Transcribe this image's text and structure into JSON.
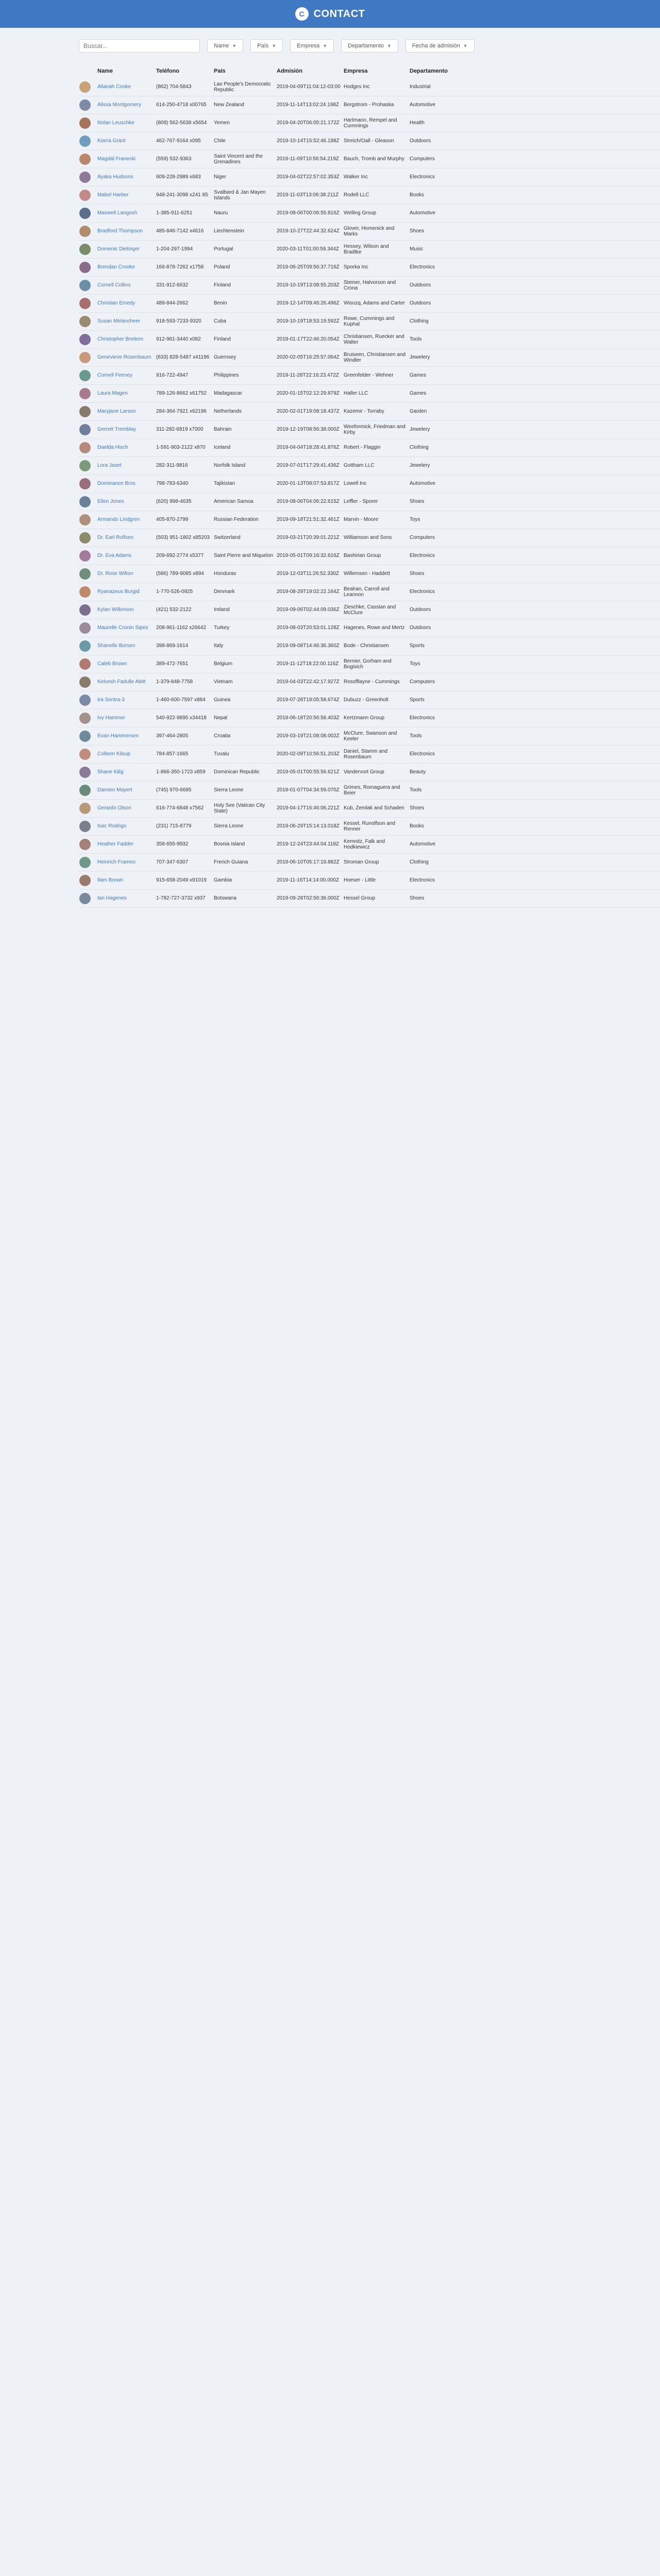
{
  "header": {
    "brand": "CONTACT",
    "logo_glyph": "C"
  },
  "filters": {
    "search_placeholder": "Buscar...",
    "name": "Name",
    "pais": "País",
    "empresa": "Empresa",
    "departamento": "Departamento",
    "fecha": "Fecha de admisión"
  },
  "columns": [
    "Name",
    "Teléfono",
    "País",
    "Admisión",
    "Empresa",
    "Departamento"
  ],
  "rows": [
    {
      "name": "Allanah Cooke",
      "phone": "(862) 704-5843",
      "pais": "Lao People's Democratic Republic",
      "admision": "2019-04-09T11:04:12-03:00",
      "empresa": "Hodges Inc",
      "dep": "Industrial",
      "color": "#c9a27a"
    },
    {
      "name": "Alissa Montgomery",
      "phone": "614-250-4718 x00765",
      "pais": "New Zealand",
      "admision": "2019-11-14T13:02:24.198Z",
      "empresa": "Bergstrom - Prohaska",
      "dep": "Automotive",
      "color": "#7d8aa6"
    },
    {
      "name": "Nolan Leuschke",
      "phone": "(809) 562-5638 x5654",
      "pais": "Yemen",
      "admision": "2019-04-20T06:05:21.172Z",
      "empresa": "Hartmann, Rempel and Cummings",
      "dep": "Health",
      "color": "#a5735a"
    },
    {
      "name": "Kiarra Grant",
      "phone": "462-767-9164 x095",
      "pais": "Chile",
      "admision": "2019-10-14T15:52:46.198Z",
      "empresa": "Streich/Oall - Gleason",
      "dep": "Outdoors",
      "color": "#6f9dbf"
    },
    {
      "name": "Magdal Franecki",
      "phone": "(559) 532-9363",
      "pais": "Saint Vincent and the Grenadines",
      "admision": "2019-11-09T10:56:54.219Z",
      "empresa": "Bauch, Tromb and Murphy",
      "dep": "Computers",
      "color": "#b9876a"
    },
    {
      "name": "Ayaka Hudsons",
      "phone": "609-228-2989 x683",
      "pais": "Niger",
      "admision": "2019-04-02T22:57:02.353Z",
      "empresa": "Walker Inc",
      "dep": "Electronics",
      "color": "#8f7a9c"
    },
    {
      "name": "Mabel Harber",
      "phone": "948-241-3098 x241 85",
      "pais": "Svalbard & Jan Mayen Islands",
      "admision": "2019-11-03T13:06:38.211Z",
      "empresa": "Rodell LLC",
      "dep": "Books",
      "color": "#c48a8a"
    },
    {
      "name": "Maxwell Langosh",
      "phone": "1-385-911-6251",
      "pais": "Nauru",
      "admision": "2019-08-06T00:06:55.816Z",
      "empresa": "Welling Group",
      "dep": "Automotive",
      "color": "#5a6f8c"
    },
    {
      "name": "Bradford Thompson",
      "phone": "485-846-7142 x4616",
      "pais": "Liechtenstein",
      "admision": "2019-10-27T22:44:32.624Z",
      "empresa": "Glover, Homenick and Marks",
      "dep": "Shoes",
      "color": "#b08e6c"
    },
    {
      "name": "Domenic Dietinger",
      "phone": "1-204-297-1994",
      "pais": "Portugal",
      "admision": "2020-03-11T01:00:59.344Z",
      "empresa": "Hessey, Wilson and Bradtke",
      "dep": "Music",
      "color": "#7a8c6a"
    },
    {
      "name": "Brendan Crooke",
      "phone": "166-878-7262 x1758",
      "pais": "Poland",
      "admision": "2019-06-25T09:56:37.716Z",
      "empresa": "Sporka Inc",
      "dep": "Electronics",
      "color": "#8c6a8a"
    },
    {
      "name": "Cornell Collins",
      "phone": "331-912-6632",
      "pais": "Finland",
      "admision": "2019-10-19T13:08:55.203Z",
      "empresa": "Steiner, Halvorson and Crona",
      "dep": "Outdoors",
      "color": "#6a8fa6"
    },
    {
      "name": "Christian Emedy",
      "phone": "489-844-2662",
      "pais": "Benin",
      "admision": "2019-12-14T09:46:26.496Z",
      "empresa": "Wisozq, Adams and Carter",
      "dep": "Outdoors",
      "color": "#a6706a"
    },
    {
      "name": "Susan Melancheer",
      "phone": "918-593-7233-9320",
      "pais": "Cuba",
      "admision": "2019-10-19T18:53:19.592Z",
      "empresa": "Rowe, Cummings and Kuphal",
      "dep": "Clothing",
      "color": "#9a8a6f"
    },
    {
      "name": "Christopher Breitem",
      "phone": "912-961-3440 x082",
      "pais": "Finland",
      "admision": "2019-01-17T22:46:20.054Z",
      "empresa": "Christiansen, Ruecker and Walter",
      "dep": "Tools",
      "color": "#7f6f9a"
    },
    {
      "name": "Genevieve Rosenbaum",
      "phone": "(633) 828-5487 x41196",
      "pais": "Guernsey",
      "admision": "2020-02-05T16:25:57.064Z",
      "empresa": "Bruiseen, Christiansen and Windler",
      "dep": "Jewelery",
      "color": "#c79a7c"
    },
    {
      "name": "Cornell Feeney",
      "phone": "916-722-4947",
      "pais": "Philippines",
      "admision": "2019-11-28T22:16:23.472Z",
      "empresa": "Greenfelder - Wehner",
      "dep": "Games",
      "color": "#6a9a8c"
    },
    {
      "name": "Laura Magen",
      "phone": "789-126-8662 x61752",
      "pais": "Madagascar",
      "admision": "2020-01-15T02:12:29.879Z",
      "empresa": "Haller LLC",
      "dep": "Games",
      "color": "#a67c8c"
    },
    {
      "name": "Maryjane Larson",
      "phone": "284-364-7921 x62196",
      "pais": "Netherlands",
      "admision": "2020-02-01T19:08:18.437Z",
      "empresa": "Kazemir - Torraby",
      "dep": "Garden",
      "color": "#8a7a6a"
    },
    {
      "name": "Gerrett Tremblay",
      "phone": "311-282-6819 x7000",
      "pais": "Bahrain",
      "admision": "2019-12-19T08:56:38.000Z",
      "empresa": "Weeformick, Friedman and Kirby",
      "dep": "Jewelery",
      "color": "#6f7f9c"
    },
    {
      "name": "Daelda Hisch",
      "phone": "1-591-903-2122 x870",
      "pais": "Iceland",
      "admision": "2019-04-04T18:28:41.876Z",
      "empresa": "Robert - Flaggin",
      "dep": "Clothing",
      "color": "#b58a7a"
    },
    {
      "name": "Lora Jaset",
      "phone": "282-311-9816",
      "pais": "Norfolk Island",
      "admision": "2019-07-01T17:29:41.436Z",
      "empresa": "Gottham LLC",
      "dep": "Jewelery",
      "color": "#7c9a7a"
    },
    {
      "name": "Dominance Bros",
      "phone": "798-783-6340",
      "pais": "Tajikistan",
      "admision": "2020-01-13T08:07:53.817Z",
      "empresa": "Lowell Inc",
      "dep": "Automotive",
      "color": "#9a6f7a"
    },
    {
      "name": "Ellen Jones",
      "phone": "(620) 998-4635",
      "pais": "American Samoa",
      "admision": "2019-08-06T04:06:22.615Z",
      "empresa": "Leffler - Sporer",
      "dep": "Shoes",
      "color": "#6a7f9a"
    },
    {
      "name": "Armando Lindgren",
      "phone": "405-870-2799",
      "pais": "Russian Federation",
      "admision": "2019-09-18T21:51:32.461Z",
      "empresa": "Marvin - Moore",
      "dep": "Toys",
      "color": "#b0907a"
    },
    {
      "name": "Dr. Earl Rolfsen",
      "phone": "(503) 951-1802 x85203",
      "pais": "Switzerland",
      "admision": "2019-03-21T20:39:01.221Z",
      "empresa": "Williamson and Sons",
      "dep": "Computers",
      "color": "#8c8c6a"
    },
    {
      "name": "Dr. Eva Adams",
      "phone": "209-692-2774 x5377",
      "pais": "Saint Pierre and Miquelon",
      "admision": "2019-05-01T09:16:32.616Z",
      "empresa": "Bashirian Group",
      "dep": "Electronics",
      "color": "#a67a9a"
    },
    {
      "name": "Dr. Rose Wilton",
      "phone": "(586) 789-9085 x894",
      "pais": "Honduras",
      "admision": "2019-12-03T11:26:52.330Z",
      "empresa": "Willemsen - Haddett",
      "dep": "Shoes",
      "color": "#6f8f7a"
    },
    {
      "name": "Ryanazeus Burgid",
      "phone": "1-770-526-0925",
      "pais": "Denmark",
      "admision": "2019-08-29T19:02:22.164Z",
      "empresa": "Beahan, Carroll and Leannon",
      "dep": "Electronics",
      "color": "#c08a6a"
    },
    {
      "name": "Kylan Wilkinson",
      "phone": "(421) 532-2122",
      "pais": "Ireland",
      "admision": "2019-09-06T02:44:09.036Z",
      "empresa": "Zieschke, Cassian and McClure",
      "dep": "Outdoors",
      "color": "#7a6f8c"
    },
    {
      "name": "Maurelle Cronin Sipes",
      "phone": "208-961-1162 x26642",
      "pais": "Turkey",
      "admision": "2019-08-03T20:53:01.128Z",
      "empresa": "Hagenes, Rowe and Mertz",
      "dep": "Outdoors",
      "color": "#9a8a9c"
    },
    {
      "name": "Shanelle Borsen",
      "phone": "398-869-1614",
      "pais": "Italy",
      "admision": "2019-09-08T14:46:36.360Z",
      "empresa": "Bode - Christiansen",
      "dep": "Sports",
      "color": "#6a9aa6"
    },
    {
      "name": "Caleb Brown",
      "phone": "389-472-7651",
      "pais": "Belgium",
      "admision": "2019-11-12T18:22:00.116Z",
      "empresa": "Bernier, Gorham and Bogisich",
      "dep": "Toys",
      "color": "#b07a6f"
    },
    {
      "name": "Kelvesh Fadulle Abitt",
      "phone": "1-379-848-7758",
      "pais": "Vietnam",
      "admision": "2019-04-03T22:42:17.927Z",
      "empresa": "Rossfflayne - Cummings",
      "dep": "Computers",
      "color": "#8a7c6a"
    },
    {
      "name": "Ira Sentra-3",
      "phone": "1-460-600-7597 x884",
      "pais": "Guinea",
      "admision": "2019-07-28T19:05:58.674Z",
      "empresa": "Dubuzz - Greenholt",
      "dep": "Sports",
      "color": "#7c8aa6"
    },
    {
      "name": "Ivy Hammer",
      "phone": "540-922-9895 x34418",
      "pais": "Nepal",
      "admision": "2019-06-18T20:56:58.403Z",
      "empresa": "Kertzmann Group",
      "dep": "Electronics",
      "color": "#a6908a"
    },
    {
      "name": "Evan Hammersen",
      "phone": "397-464-2805",
      "pais": "Croatia",
      "admision": "2019-03-19T21:08:08.002Z",
      "empresa": "McClure, Swanson and Keeler",
      "dep": "Tools",
      "color": "#6f8a9a"
    },
    {
      "name": "Colleen Kilsup",
      "phone": "784-857-1665",
      "pais": "Tuvalu",
      "admision": "2020-02-09T10:56:51.203Z",
      "empresa": "Daniel, Stamm and Rosenbaum",
      "dep": "Electronics",
      "color": "#c08c7c"
    },
    {
      "name": "Shane Kilig",
      "phone": "1-866-350-1723 x859",
      "pais": "Dominican Republic",
      "admision": "2019-05-01T00:55:56.621Z",
      "empresa": "Vandervort Group",
      "dep": "Beauty",
      "color": "#8c7a9a"
    },
    {
      "name": "Damien Mayert",
      "phone": "(745) 970-6695",
      "pais": "Sierra Leone",
      "admision": "2019-01-07T04:34:59.070Z",
      "empresa": "Grimes, Romaguera and Beier",
      "dep": "Tools",
      "color": "#6a8c7c"
    },
    {
      "name": "Gerardo Olson",
      "phone": "616-774-6848 x7562",
      "pais": "Holy See (Vatican City State)",
      "admision": "2019-04-17T16:46:06.221Z",
      "empresa": "Kub, Zemlak and Schaden",
      "dep": "Shoes",
      "color": "#b89a7a"
    },
    {
      "name": "Isac Rodrigo",
      "phone": "(231) 715-8779",
      "pais": "Sierra Leone",
      "admision": "2019-06-29T15:14:13.018Z",
      "empresa": "Kessel, Runolfson and Renner",
      "dep": "Books",
      "color": "#7a7f8c"
    },
    {
      "name": "Heather Fadder",
      "phone": "358-655-9932",
      "pais": "Bosnia Island",
      "admision": "2019-12-24T23:44:04.118Z",
      "empresa": "Kemnitz, Falk and Hodkiewicz",
      "dep": "Automotive",
      "color": "#a6807a"
    },
    {
      "name": "Heinrich Frameo",
      "phone": "707-347-6307",
      "pais": "French Guiana",
      "admision": "2019-06-10T05:17:19.882Z",
      "empresa": "Stroman Group",
      "dep": "Clothing",
      "color": "#6f9a8a"
    },
    {
      "name": "Ilam Brown",
      "phone": "915-658-2049 x91019",
      "pais": "Gambia",
      "admision": "2019-11-16T14:14:00.000Z",
      "empresa": "Hoeser - Little",
      "dep": "Electronics",
      "color": "#9a7a6a"
    },
    {
      "name": "Ian Hagenes",
      "phone": "1-782-727-3732 x937",
      "pais": "Botswana",
      "admision": "2019-09-28T02:56:36.000Z",
      "empresa": "Hessel Group",
      "dep": "Shoes",
      "color": "#7a8a9c"
    }
  ]
}
